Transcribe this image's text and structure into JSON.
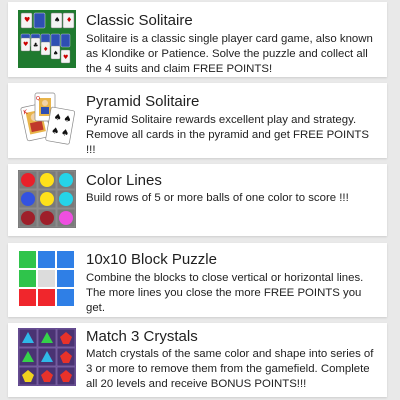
{
  "games": [
    {
      "title": "Classic Solitaire",
      "description": "Solitaire is a classic single player card game, also known as Klondike or Patience. Solve the puzzle and collect all the 4 suits and claim FREE POINTS!",
      "thumbnail_icon": "klondike-solitaire-icon"
    },
    {
      "title": "Pyramid Solitaire",
      "description": "Pyramid Solitaire rewards excellent play and strategy. Remove all cards in the pyramid and get FREE POINTS !!!",
      "thumbnail_icon": "pyramid-playing-cards-icon"
    },
    {
      "title": "Color Lines",
      "description": "Build rows of 5 or more balls of one color to score !!!",
      "thumbnail_icon": "color-balls-grid-icon"
    },
    {
      "title": "10x10 Block Puzzle",
      "description": "Combine the blocks to close vertical or horizontal lines. The more lines you close the more FREE POINTS you get.",
      "thumbnail_icon": "colored-blocks-icon"
    },
    {
      "title": "Match 3 Crystals",
      "description": "Match crystals of the same color and shape into series of 3 or more to remove them from the gamefield. Complete all 20 levels and receive BONUS POINTS!!!",
      "thumbnail_icon": "crystals-grid-icon"
    }
  ],
  "colors": {
    "page_background": "#e9e9e9",
    "card_background": "#ffffff",
    "solitaire_felt": "#1f7a2f",
    "crystal_board": "#5a3f86"
  }
}
